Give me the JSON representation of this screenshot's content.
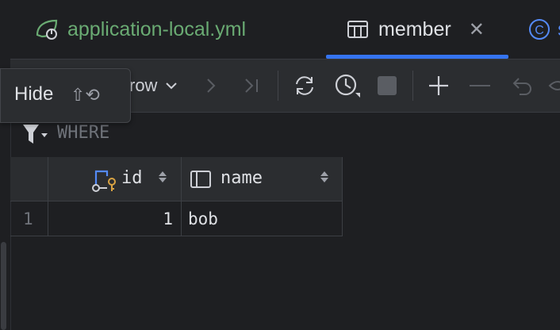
{
  "tabs": [
    {
      "label": "application-local.yml",
      "icon": "spring-leaf-icon",
      "color": "#6aab73"
    },
    {
      "label": "member",
      "icon": "table-icon",
      "active": true
    },
    {
      "label": "s",
      "icon": "class-icon",
      "color": "#548af7"
    }
  ],
  "toolbar": {
    "row_label": "row",
    "icons": [
      "chevron-down-icon",
      "next-icon",
      "last-icon",
      "refresh-icon",
      "history-icon",
      "stop-icon",
      "add-row-icon",
      "delete-row-icon",
      "revert-icon",
      "preview-icon"
    ]
  },
  "tooltip": {
    "label": "Hide",
    "shortcut": "⇧⟲"
  },
  "filter": {
    "placeholder": "WHERE"
  },
  "table": {
    "columns": [
      {
        "name": "id",
        "type": "primary-key"
      },
      {
        "name": "name",
        "type": "column"
      }
    ],
    "rows": [
      {
        "row_number": "1",
        "id": "1",
        "name": "bob"
      }
    ]
  },
  "colors": {
    "accent": "#3574f0",
    "background": "#1e1f22",
    "toolbar": "#2b2d30"
  }
}
